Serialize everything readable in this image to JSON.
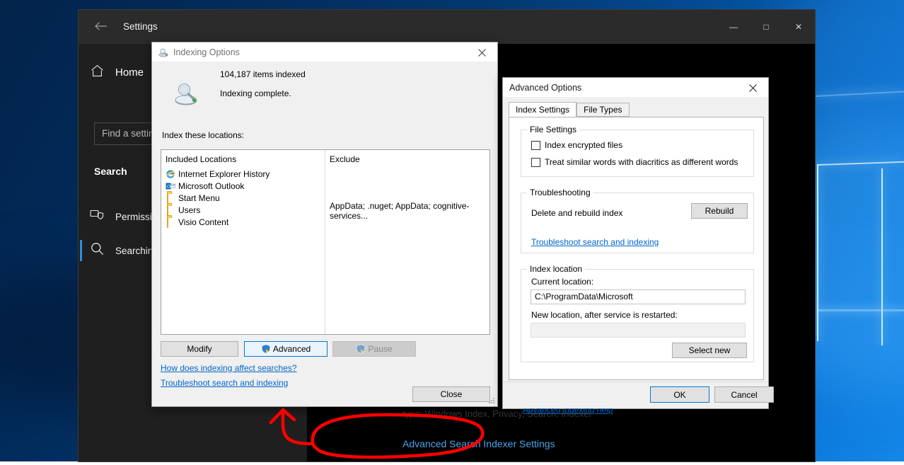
{
  "desktop": {
    "wallpaper": "windows-10-hero",
    "accent": "#0078d7"
  },
  "settings_window": {
    "title": "Settings",
    "back_icon": "back-arrow-icon",
    "window_controls": {
      "minimize": "—",
      "maximize": "□",
      "close": "✕"
    },
    "sidebar": {
      "home_label": "Home",
      "home_icon": "home-icon",
      "search_box": {
        "placeholder": "Find a setting",
        "value": ""
      },
      "section_heading": "Search",
      "items": [
        {
          "label": "Permissions",
          "icon": "permissions-shield-icon",
          "active": false
        },
        {
          "label": "Searching",
          "icon": "search-magnifier-icon",
          "active": true
        }
      ]
    },
    "content": {
      "obscured_line": "type: Windows Index, Privacy, Search, Indexer",
      "advanced_indexer_link": "Advanced Search Indexer Settings"
    }
  },
  "indexing_options": {
    "title": "Indexing Options",
    "title_icon": "indexing-options-icon",
    "close_icon": "close-icon",
    "items_indexed": "104,187 items indexed",
    "status": "Indexing complete.",
    "status_icon": "indexer-status-icon",
    "locations_label": "Index these locations:",
    "columns": {
      "included": "Included Locations",
      "exclude": "Exclude"
    },
    "locations": [
      {
        "name": "Internet Explorer History",
        "icon": "internet-explorer-icon",
        "exclude": ""
      },
      {
        "name": "Microsoft Outlook",
        "icon": "outlook-icon",
        "exclude": ""
      },
      {
        "name": "Start Menu",
        "icon": "folder-icon",
        "exclude": ""
      },
      {
        "name": "Users",
        "icon": "folder-icon",
        "exclude": "AppData; .nuget; AppData; cognitive-services..."
      },
      {
        "name": "Visio Content",
        "icon": "folder-icon",
        "exclude": ""
      }
    ],
    "buttons": {
      "modify": "Modify",
      "advanced": "Advanced",
      "pause": "Pause",
      "close": "Close"
    },
    "links": {
      "how_does": "How does indexing affect searches?",
      "troubleshoot": "Troubleshoot search and indexing"
    }
  },
  "advanced_options": {
    "title": "Advanced Options",
    "close_icon": "close-icon",
    "tabs": [
      {
        "label": "Index Settings",
        "active": true
      },
      {
        "label": "File Types",
        "active": false
      }
    ],
    "file_settings": {
      "group_title": "File Settings",
      "checkboxes": [
        {
          "label": "Index encrypted files",
          "checked": false
        },
        {
          "label": "Treat similar words with diacritics as different words",
          "checked": false
        }
      ]
    },
    "troubleshooting": {
      "group_title": "Troubleshooting",
      "rebuild_text": "Delete and rebuild index",
      "rebuild_button": "Rebuild",
      "link": "Troubleshoot search and indexing"
    },
    "index_location": {
      "group_title": "Index location",
      "current_label": "Current location:",
      "current_value": "C:\\ProgramData\\Microsoft",
      "new_label": "New location, after service is restarted:",
      "new_value": "",
      "select_new_button": "Select new"
    },
    "help_link": "Advanced indexing help",
    "footer": {
      "ok": "OK",
      "cancel": "Cancel"
    }
  },
  "annotation": {
    "type": "hand-drawn-highlight",
    "color": "#fe0000",
    "shapes": [
      "ellipse-around-advanced-search-indexer-settings",
      "arrow-pointing-up-left"
    ]
  }
}
